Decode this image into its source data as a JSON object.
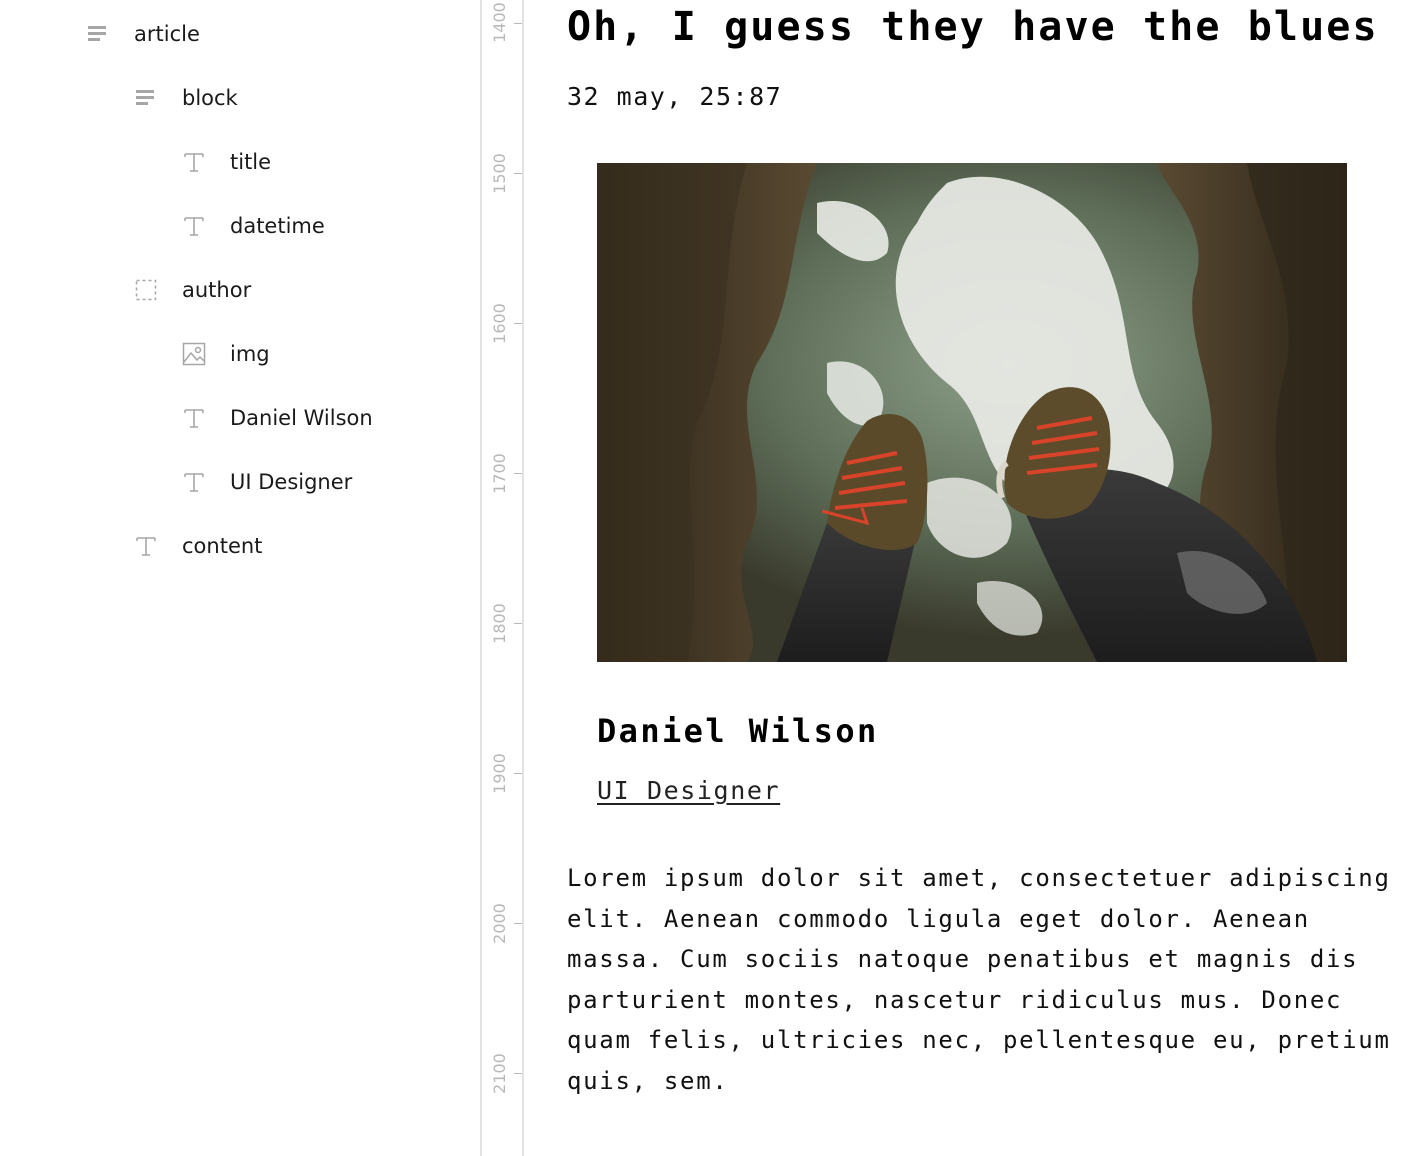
{
  "layers": {
    "items": [
      {
        "label": "article",
        "icon": "block-icon",
        "depth": 0
      },
      {
        "label": "block",
        "icon": "block-icon",
        "depth": 1
      },
      {
        "label": "title",
        "icon": "text-icon",
        "depth": 2
      },
      {
        "label": "datetime",
        "icon": "text-icon",
        "depth": 2
      },
      {
        "label": "author",
        "icon": "frame-icon",
        "depth": 1
      },
      {
        "label": "img",
        "icon": "image-icon",
        "depth": 2
      },
      {
        "label": "Daniel Wilson",
        "icon": "text-icon",
        "depth": 2
      },
      {
        "label": "UI Designer",
        "icon": "text-icon",
        "depth": 2
      },
      {
        "label": "content",
        "icon": "text-icon",
        "depth": 1
      }
    ]
  },
  "ruler": {
    "labels": [
      "1400",
      "1500",
      "1600",
      "1700",
      "1800",
      "1900",
      "2000",
      "2100"
    ]
  },
  "article": {
    "title": "Oh, I guess they have the blues",
    "datetime": "32 may, 25:87",
    "author": {
      "name": "Daniel Wilson",
      "role": "UI Designer"
    },
    "content": "Lorem ipsum dolor sit amet, consectetuer adipiscing elit. Aenean commodo ligula eget dolor. Aenean massa. Cum sociis natoque penatibus et magnis dis parturient montes, nascetur ridiculus mus. Donec quam felis, ultricies nec, pellentesque eu, pretium quis, sem."
  },
  "colors": {
    "ui_icon": "#a6a6a6",
    "divider": "#e2e2e2",
    "text": "#111111",
    "photo_laces": "#d8432a"
  }
}
